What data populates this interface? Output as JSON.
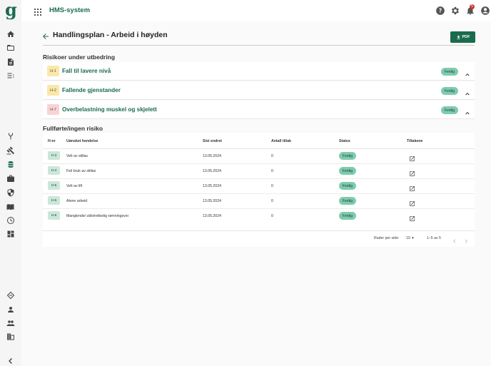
{
  "app": {
    "logo": "g",
    "title": "HMS-system",
    "notification_count": "5"
  },
  "page": {
    "title": "Handlingsplan - Arbeid i høyden",
    "pdf_label": "PDF"
  },
  "risks_section": {
    "title": "Risikoer under utbedring",
    "items": [
      {
        "code": "H-1",
        "name": "Fall til lavere nivå",
        "status": "Ferdig",
        "code_color": "#fbe7a8"
      },
      {
        "code": "H-2",
        "name": "Fallende gjenstander",
        "status": "Ferdig",
        "code_color": "#fbe7a8"
      },
      {
        "code": "H-7",
        "name": "Overbelastning muskel og skjelett",
        "status": "Ferdig",
        "code_color": "#f9d3d6"
      }
    ]
  },
  "completed_section": {
    "title": "Fullførte/ingen risiko",
    "columns": [
      "H-nr",
      "Uønsket hendelse",
      "Sist endret",
      "Antall tiltak",
      "Status",
      "Tiltakene"
    ],
    "rows": [
      {
        "code": "H-3",
        "event": "Velt av stillas",
        "changed": "13.05.2024",
        "count": "0",
        "status": "Ferdig"
      },
      {
        "code": "H-4",
        "event": "Feil bruk av stillas",
        "changed": "13.05.2024",
        "count": "0",
        "status": "Ferdig"
      },
      {
        "code": "H-5",
        "event": "Velt av lift",
        "changed": "13.05.2024",
        "count": "0",
        "status": "Ferdig"
      },
      {
        "code": "H-6",
        "event": "Alene arbeid",
        "changed": "13.05.2024",
        "count": "0",
        "status": "Ferdig"
      },
      {
        "code": "H-8",
        "event": "Manglende/ utilstrekkelig rømningsvei",
        "changed": "13.05.2024",
        "count": "0",
        "status": "Ferdig"
      }
    ],
    "rows_per_page_label": "Rader per side:",
    "rows_per_page_value": "10",
    "range_label": "1–5 av 5"
  },
  "colors": {
    "brand": "#1b6b4e",
    "status_pill": "#7ecbae",
    "code_green": "#c9e8da"
  }
}
